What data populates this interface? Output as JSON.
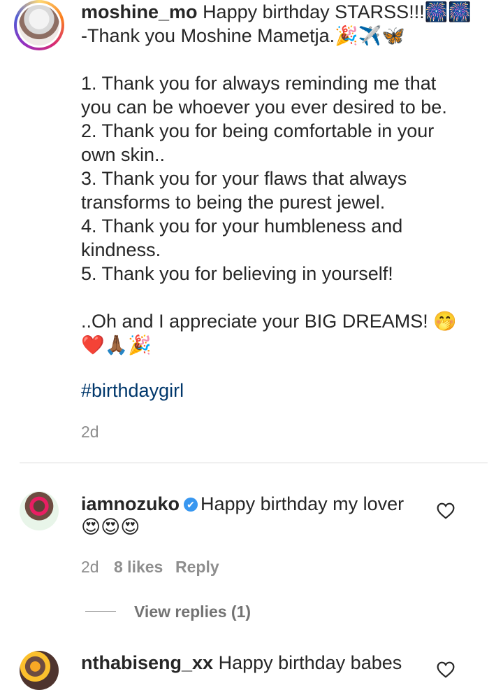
{
  "comments": [
    {
      "username": "moshine_mo",
      "text_line1": "Happy birthday STARSS!!!🎆🎆",
      "text_body": "-Thank you Moshine Mametja.🎉✈️🦋\n\n1. Thank you for always reminding me that\nyou can be whoever you ever desired to be.\n2. Thank you for being comfortable in your\nown skin..\n3. Thank you for your flaws that always\ntransforms to being the purest jewel.\n4. Thank you for your humbleness and\nkindness.\n5. Thank you for believing in yourself!\n\n..Oh and I appreciate your BIG DREAMS! 🤭\n❤️🙏🏾🎉",
      "hashtag": "#birthdaygirl",
      "time": "2d"
    },
    {
      "username": "iamnozuko",
      "verified_icon": "✔",
      "text": "Happy birthday my lover",
      "emojis": "😍😍😍",
      "time": "2d",
      "likes": "8 likes",
      "reply_label": "Reply",
      "view_replies": "View replies (1)"
    },
    {
      "username": "nthabiseng_xx",
      "text": "Happy birthday babes"
    }
  ],
  "icons": {
    "like": "heart-outline-icon"
  },
  "colors": {
    "hashtag": "#00376b",
    "verified": "#3897f0",
    "meta": "#8e8e8e"
  }
}
